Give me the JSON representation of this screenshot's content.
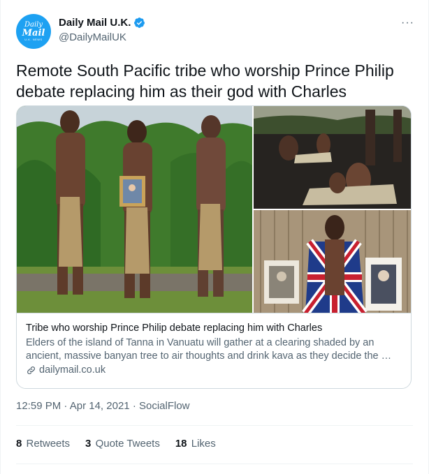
{
  "author": {
    "display_name": "Daily Mail U.K.",
    "handle": "@DailyMailUK",
    "verified": true,
    "avatar_text": [
      "Daily",
      "Mail",
      "U.K. NEWS"
    ],
    "avatar_color": "#1da1f2"
  },
  "more_icon": "···",
  "tweet_text": "Remote South Pacific tribe who worship Prince Philip debate replacing him as their god with Charles",
  "card": {
    "title": "Tribe who worship Prince Philip debate replacing him with Charles",
    "description": "Elders of the island of Tanna in Vanuatu will gather at a clearing shaded by an ancient, massive banyan tree to air thoughts and drink kava as they decide the …",
    "domain": "dailymail.co.uk"
  },
  "meta": {
    "time": "12:59 PM",
    "separator": "·",
    "date": "Apr 14, 2021",
    "source": "SocialFlow"
  },
  "stats": {
    "retweets_count": "8",
    "retweets_label": "Retweets",
    "quotes_count": "3",
    "quotes_label": "Quote Tweets",
    "likes_count": "18",
    "likes_label": "Likes"
  },
  "colors": {
    "text_primary": "#0f1419",
    "text_secondary": "#536471",
    "verified_blue": "#1d9bf0",
    "border": "#cfd9de"
  }
}
